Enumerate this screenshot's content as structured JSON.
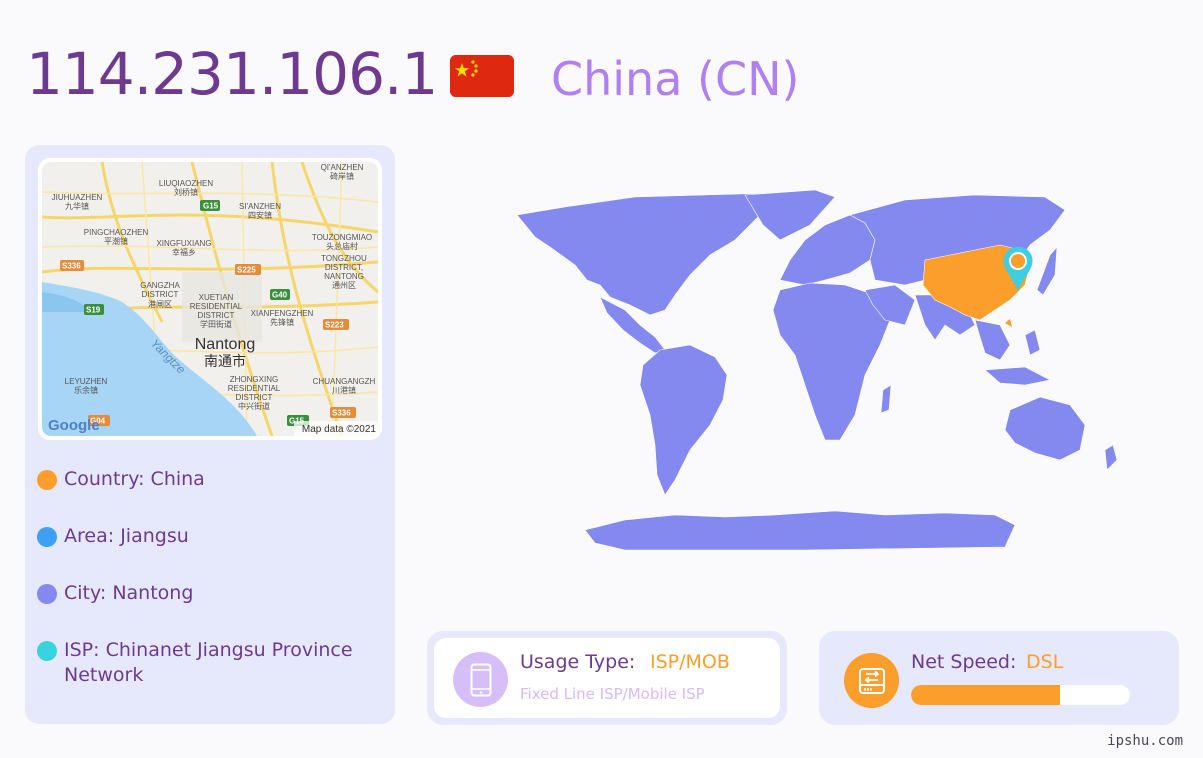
{
  "header": {
    "ip": "114.231.106.1",
    "country": "China (CN)"
  },
  "mini_map": {
    "city_name": "Nantong",
    "city_name_cn": "南通市",
    "river_label": "Yangtze",
    "attribution": "Map data ©2021",
    "logo": "Google",
    "place_labels": [
      [
        "QI'ANZHEN",
        "碕岸镇"
      ],
      [
        "LIUQIAOZHEN",
        "刘桥镇"
      ],
      [
        "JIUHUAZHEN",
        "九华镇"
      ],
      [
        "SI'ANZHEN",
        "四安镇"
      ],
      [
        "PINGCHAOZHEN",
        "平潮镇"
      ],
      [
        "XINGFUXIANG",
        "幸福乡"
      ],
      [
        "TOUZONGMIAO",
        "头总庙村"
      ],
      [
        "TONGZHOU",
        "DISTRICT,"
      ],
      [
        "NANTONG",
        "通州区"
      ],
      [
        "GANGZHA",
        "DISTRICT"
      ],
      [
        "港闸区",
        ""
      ],
      [
        "XUETIAN",
        "RESIDENTIAL"
      ],
      [
        "DISTRICT",
        "学田街道"
      ],
      [
        "XIANFENGZHEN",
        "先锋镇"
      ],
      [
        "LEYUZHEN",
        "乐余镇"
      ],
      [
        "ZHONGXING",
        "RESIDENTIAL"
      ],
      [
        "DISTRICT",
        "中兴街道"
      ],
      [
        "CHUANGANGZH",
        "川港镇"
      ]
    ],
    "road_labels": [
      "G15",
      "S336",
      "S225",
      "G40",
      "S19",
      "S223",
      "S336",
      "G15",
      "G04"
    ]
  },
  "info": {
    "country_label": "Country:",
    "country_value": "China",
    "area_label": "Area:",
    "area_value": "Jiangsu",
    "city_label": "City:",
    "city_value": "Nantong",
    "isp_label": "ISP:",
    "isp_value": "Chinanet Jiangsu Province Network"
  },
  "usage": {
    "title": "Usage Type:",
    "value": "ISP/MOB",
    "description": "Fixed Line ISP/Mobile ISP"
  },
  "speed": {
    "title": "Net Speed:",
    "value": "DSL",
    "fill_fraction": 0.68
  },
  "footer": {
    "watermark": "ipshu.com"
  },
  "colors": {
    "primary_purple": "#6e3a91",
    "light_purple": "#b07ff0",
    "orange": "#fb9e2b",
    "map_blue": "#8389ef",
    "panel_bg": "#e6e9fb",
    "dot_country": "#fb9e2b",
    "dot_area": "#3da0f4",
    "dot_city": "#8389ef",
    "dot_isp": "#39d3e0",
    "pin": "#3fcde0"
  },
  "icons": {
    "usage": "smartphone-icon",
    "speed": "network-drive-icon",
    "pin": "map-pin-icon"
  }
}
